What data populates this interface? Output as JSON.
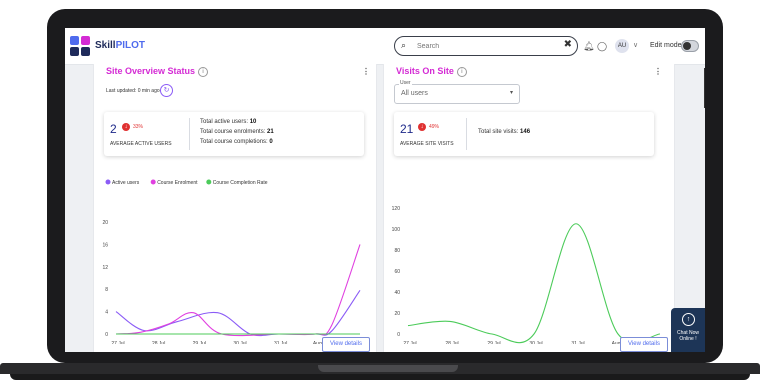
{
  "app": {
    "logo_prefix": "Skill",
    "logo_suffix": "PILOT",
    "brand_color": "#d42bd4",
    "accent": "#4f6bed"
  },
  "search": {
    "placeholder": "Search",
    "clear_icon": "close-icon",
    "icon": "search-icon"
  },
  "header": {
    "avatar_initials": "AU",
    "edit_mode_label": "Edit mode",
    "edit_mode_on": false
  },
  "site_overview": {
    "title": "Site Overview Status",
    "last_updated": "Last updated: 0 min ago",
    "active_users_value": "2",
    "change_pct": "33%",
    "avg_label": "AVERAGE ACTIVE USERS",
    "lines": [
      {
        "label": "Total active users: ",
        "value": "10"
      },
      {
        "label": "Total course enrolments: ",
        "value": "21"
      },
      {
        "label": "Total course completions: ",
        "value": "0"
      }
    ],
    "view_details": "View details"
  },
  "visits": {
    "title": "Visits On Site",
    "select_label": "User",
    "select_value": "All users",
    "visits_value": "21",
    "change_pct": "49%",
    "avg_label": "AVERAGE SITE VISITS",
    "total_label": "Total site visits: ",
    "total_value": "146",
    "view_details": "View details"
  },
  "chat": {
    "label_line1": "Chat Now",
    "label_line2": "Online !"
  },
  "chart_data": [
    {
      "type": "line",
      "x": [
        "27 Jul",
        "",
        "29 Jul",
        "",
        "30 Jul",
        "",
        "31 Jul",
        "",
        "Aug '22",
        ""
      ],
      "xticks": [
        "27 Jul",
        "28 Jul",
        "29 Jul",
        "30 Jul",
        "31 Jul",
        "Aug '22"
      ],
      "yticks": [
        0,
        4,
        8,
        12,
        16,
        20
      ],
      "ylim": [
        0,
        20
      ],
      "legend_position": "top-left",
      "series": [
        {
          "name": "Active users",
          "color": "#8b5cf6",
          "points": [
            [
              0,
              4
            ],
            [
              0.7,
              0.6
            ],
            [
              1.5,
              2.2
            ],
            [
              2.5,
              3.8
            ],
            [
              3.3,
              0
            ],
            [
              4,
              0
            ],
            [
              4.9,
              0
            ],
            [
              5.3,
              0.5
            ],
            [
              6,
              7.8
            ]
          ]
        },
        {
          "name": "Course Enrolment",
          "color": "#e040e0",
          "points": [
            [
              0,
              0
            ],
            [
              0.6,
              0.3
            ],
            [
              1.3,
              1.8
            ],
            [
              1.9,
              3.8
            ],
            [
              2.6,
              0
            ],
            [
              4,
              0
            ],
            [
              4.9,
              0
            ],
            [
              5.3,
              1.5
            ],
            [
              6,
              16
            ]
          ]
        },
        {
          "name": "Course Completion Rate",
          "color": "#4ccb5a",
          "points": [
            [
              0,
              0
            ],
            [
              6,
              0
            ]
          ]
        }
      ]
    },
    {
      "type": "line",
      "x": [
        "27 Jul",
        "28 Jul",
        "29 Jul",
        "30 Jul",
        "31 Jul",
        "Aug '22"
      ],
      "xticks": [
        "27 Jul",
        "28 Jul",
        "29 Jul",
        "30 Jul",
        "31 Jul",
        "Aug '22"
      ],
      "yticks": [
        0,
        20,
        40,
        60,
        80,
        100,
        120
      ],
      "ylim": [
        0,
        120
      ],
      "series": [
        {
          "name": "",
          "color": "#4ccb5a",
          "points": [
            [
              0,
              8
            ],
            [
              1,
              12
            ],
            [
              2,
              0
            ],
            [
              3,
              0
            ],
            [
              4,
              105
            ],
            [
              5,
              0
            ],
            [
              6,
              0
            ]
          ]
        }
      ]
    }
  ]
}
